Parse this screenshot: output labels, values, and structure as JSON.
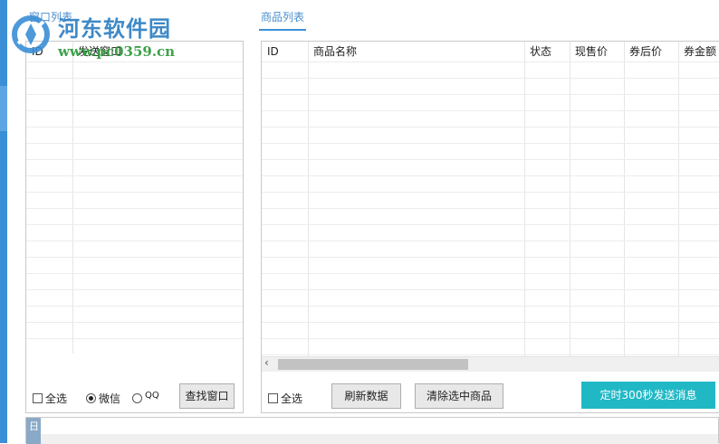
{
  "tabs": {
    "window_list": "窗口列表",
    "product_list": "商品列表"
  },
  "watermark": {
    "title": "河东软件园",
    "url": "www.pc0359.cn"
  },
  "window_table": {
    "columns": [
      "ID",
      "发送窗口"
    ],
    "rows": []
  },
  "product_table": {
    "columns": [
      "ID",
      "商品名称",
      "状态",
      "现售价",
      "券后价",
      "券金额"
    ],
    "rows": []
  },
  "left_controls": {
    "select_all": "全选",
    "wechat": "微信",
    "qq": "QQ",
    "selected_channel": "wechat",
    "find_window": "查找窗口"
  },
  "right_controls": {
    "select_all": "全选",
    "refresh": "刷新数据",
    "clear_selected": "清除选中商品",
    "timed_send": "定时300秒发送消息"
  },
  "log": {
    "gutter_label": "日"
  },
  "colors": {
    "accent": "#3b8fd6",
    "primary_button": "#21b8c6"
  }
}
